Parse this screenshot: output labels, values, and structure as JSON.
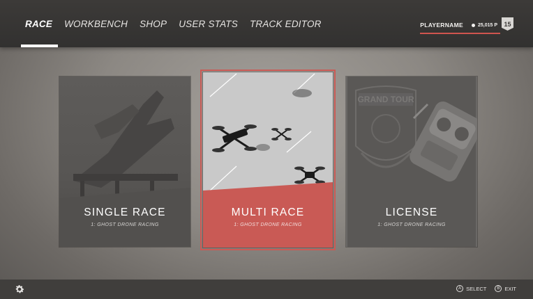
{
  "nav": {
    "tabs": [
      {
        "label": "RACE",
        "active": true
      },
      {
        "label": "WORKBENCH",
        "active": false
      },
      {
        "label": "SHOP",
        "active": false
      },
      {
        "label": "USER STATS",
        "active": false
      },
      {
        "label": "TRACK EDITOR",
        "active": false
      }
    ]
  },
  "player": {
    "name": "PLAYERNAME",
    "currency": "25,015 P",
    "level": "15"
  },
  "cards": [
    {
      "title": "SINGLE RACE",
      "subtitle": "1: GHOST DRONE RACING",
      "selected": false
    },
    {
      "title": "MULTI RACE",
      "subtitle": "1: GHOST DRONE RACING",
      "selected": true
    },
    {
      "title": "LICENSE",
      "subtitle": "1: GHOST DRONE RACING",
      "selected": false
    }
  ],
  "license_art": {
    "emblem_text": "GRAND TOUR"
  },
  "footer": {
    "settings_icon": "gear-icon",
    "select": {
      "button": "A",
      "label": "SELECT"
    },
    "exit": {
      "button": "B",
      "label": "EXIT"
    }
  },
  "colors": {
    "accent": "#c95a55",
    "topbar": "#363433",
    "bottombar": "#403e3c"
  }
}
